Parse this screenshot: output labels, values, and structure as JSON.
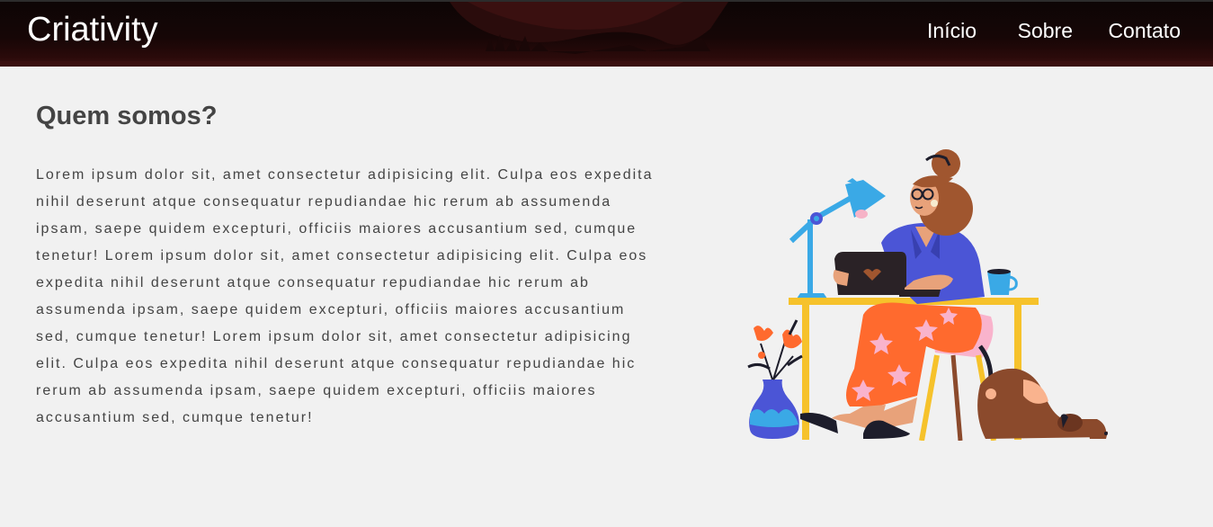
{
  "header": {
    "logo": "Criativity",
    "nav": [
      {
        "label": "Início"
      },
      {
        "label": "Sobre"
      },
      {
        "label": "Contato"
      }
    ]
  },
  "main": {
    "title": "Quem somos?",
    "paragraph": "Lorem ipsum dolor sit, amet consectetur adipisicing elit. Culpa eos expedita nihil deserunt atque consequatur repudiandae hic rerum ab assumenda ipsam, saepe quidem excepturi, officiis maiores accusantium sed, cumque tenetur! Lorem ipsum dolor sit, amet consectetur adipisicing elit. Culpa eos expedita nihil deserunt atque consequatur repudiandae hic rerum ab assumenda ipsam, saepe quidem excepturi, officiis maiores accusantium sed, cumque tenetur! Lorem ipsum dolor sit, amet consectetur adipisicing elit. Culpa eos expedita nihil deserunt atque consequatur repudiandae hic rerum ab assumenda ipsam, saepe quidem excepturi, officiis maiores accusantium sed, cumque tenetur!"
  },
  "colors": {
    "header_bg": "#0d0505",
    "page_bg": "#f1f1f1",
    "text": "#444444",
    "title": "#444444"
  },
  "illustration": {
    "icon": "woman-working-at-desk-illustration"
  }
}
